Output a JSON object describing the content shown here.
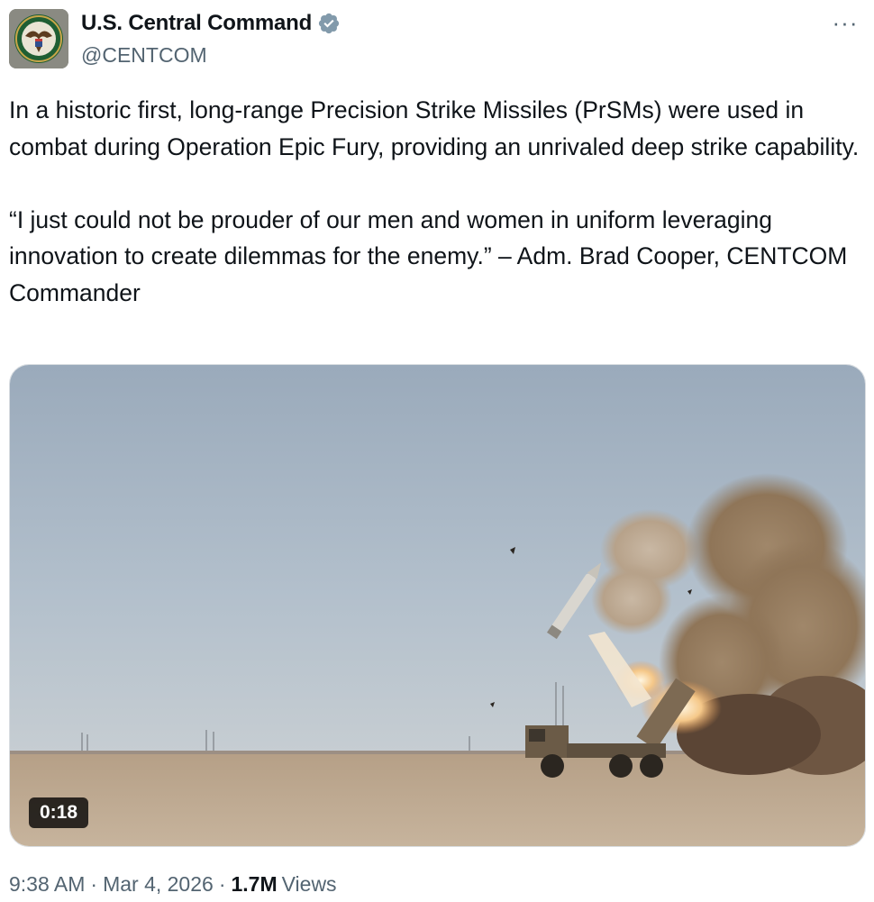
{
  "account": {
    "display_name": "U.S. Central Command",
    "handle": "@CENTCOM",
    "verified": true,
    "verified_color": "#829aab"
  },
  "tweet": {
    "paragraphs": [
      "In a historic first, long-range Precision Strike Missiles (PrSMs) were used in combat during Operation Epic Fury, providing an unrivaled deep strike capability.",
      "“I just could not be prouder of our men and women in uniform leveraging innovation to create dilemmas for the enemy.” – Adm. Brad Cooper, CENTCOM Commander"
    ]
  },
  "media": {
    "type": "video",
    "duration": "0:18"
  },
  "meta": {
    "time": "9:38 AM",
    "date": "Mar 4, 2026",
    "views_count": "1.7M",
    "views_label": "Views"
  },
  "icons": {
    "more": "more-options-icon",
    "verified": "verified-badge-icon"
  },
  "more_glyph": "···"
}
